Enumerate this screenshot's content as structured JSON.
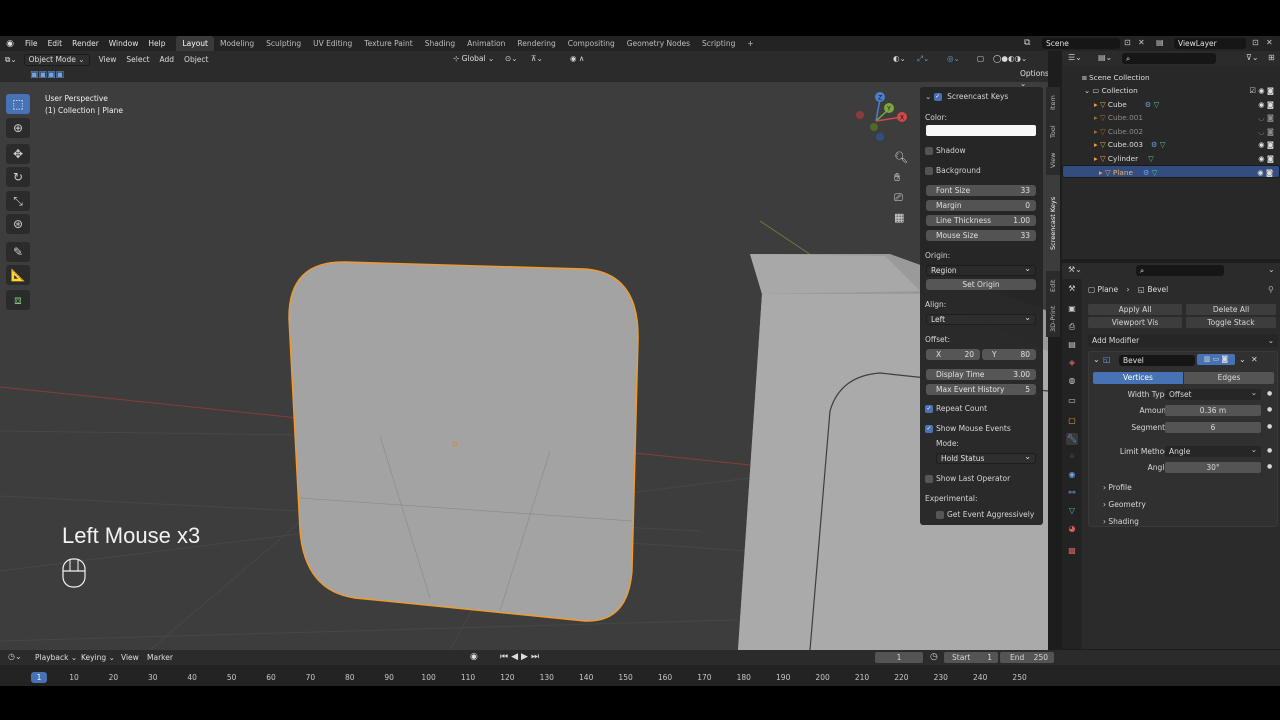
{
  "menu": [
    "File",
    "Edit",
    "Render",
    "Window",
    "Help"
  ],
  "workspaces": [
    "Layout",
    "Modeling",
    "Sculpting",
    "UV Editing",
    "Texture Paint",
    "Shading",
    "Animation",
    "Rendering",
    "Compositing",
    "Geometry Nodes",
    "Scripting"
  ],
  "add_workspace": "+",
  "scene_name": "Scene",
  "view_layer": "ViewLayer",
  "viewport": {
    "mode": "Object Mode",
    "menus": [
      "View",
      "Select",
      "Add",
      "Object"
    ],
    "transform": "Global",
    "options": "Options",
    "overlay_title": "User Perspective",
    "overlay_sub": "(1) Collection | Plane",
    "gizmo_axes": [
      "Z",
      "Y",
      "X"
    ],
    "screencast_text": "Left Mouse x3"
  },
  "npanel": {
    "title": "Screencast Keys",
    "color_label": "Color:",
    "shadow": "Shadow",
    "background": "Background",
    "font_size": {
      "label": "Font Size",
      "value": "33"
    },
    "margin": {
      "label": "Margin",
      "value": "0"
    },
    "line_thickness": {
      "label": "Line Thickness",
      "value": "1.00"
    },
    "mouse_size": {
      "label": "Mouse Size",
      "value": "33"
    },
    "origin_label": "Origin:",
    "origin_value": "Region",
    "set_origin": "Set Origin",
    "align_label": "Align:",
    "align_value": "Left",
    "offset_label": "Offset:",
    "offset_x_label": "X",
    "offset_x": "20",
    "offset_y_label": "Y",
    "offset_y": "80",
    "display_time": {
      "label": "Display Time",
      "value": "3.00"
    },
    "max_event": {
      "label": "Max Event History",
      "value": "5"
    },
    "repeat_count": "Repeat Count",
    "show_mouse": "Show Mouse Events",
    "mode_label": "Mode:",
    "mode_value": "Hold Status",
    "show_last": "Show Last Operator",
    "experimental": "Experimental:",
    "get_event": "Get Event Aggressively",
    "tabs": [
      "Item",
      "Tool",
      "View",
      "Screencast Keys",
      "Edit",
      "3D-Print"
    ]
  },
  "outliner": {
    "root": "Scene Collection",
    "collection": "Collection",
    "items": [
      "Cube",
      "Cube.001",
      "Cube.002",
      "Cube.003",
      "Cylinder",
      "Plane"
    ]
  },
  "properties": {
    "breadcrumb_object": "Plane",
    "breadcrumb_mod": "Bevel",
    "apply_all": "Apply All",
    "delete_all": "Delete All",
    "viewport_vis": "Viewport Vis",
    "toggle_stack": "Toggle Stack",
    "add_modifier": "Add Modifier",
    "modifier_name": "Bevel",
    "tab_vertices": "Vertices",
    "tab_edges": "Edges",
    "width_type_label": "Width Type",
    "width_type": "Offset",
    "amount_label": "Amount",
    "amount": "0.36 m",
    "segments_label": "Segments",
    "segments": "6",
    "limit_label": "Limit Method",
    "limit": "Angle",
    "angle_label": "Angle",
    "angle": "30°",
    "sections": [
      "Profile",
      "Geometry",
      "Shading"
    ]
  },
  "timeline": {
    "menus": [
      "Playback",
      "Keying",
      "View",
      "Marker"
    ],
    "current_frame": "1",
    "start_label": "Start",
    "start": "1",
    "end_label": "End",
    "end": "250",
    "ticks": [
      "1",
      "10",
      "20",
      "30",
      "40",
      "50",
      "60",
      "70",
      "80",
      "90",
      "100",
      "110",
      "120",
      "130",
      "140",
      "150",
      "160",
      "170",
      "180",
      "190",
      "200",
      "210",
      "220",
      "230",
      "240",
      "250"
    ]
  }
}
